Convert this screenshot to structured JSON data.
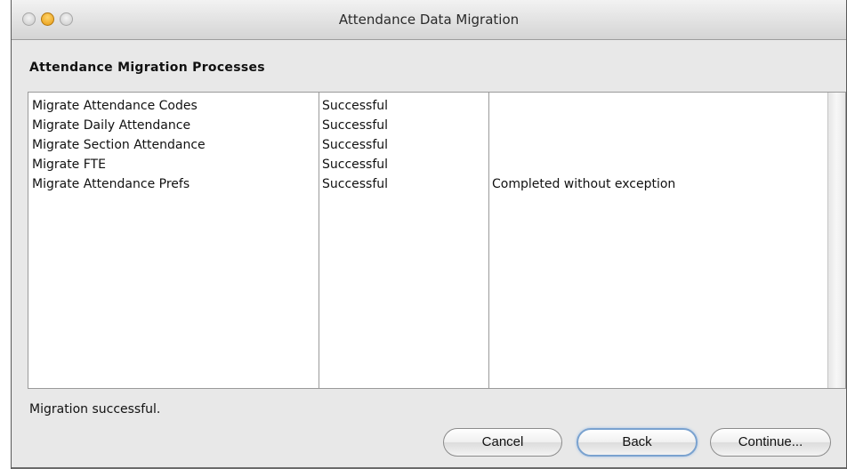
{
  "window": {
    "title": "Attendance Data Migration"
  },
  "section_heading": "Attendance Migration Processes",
  "table": {
    "rows": [
      {
        "process": "Migrate Attendance Codes",
        "result": "Successful",
        "message": ""
      },
      {
        "process": "Migrate Daily Attendance",
        "result": "Successful",
        "message": ""
      },
      {
        "process": "Migrate Section Attendance",
        "result": "Successful",
        "message": ""
      },
      {
        "process": "Migrate FTE",
        "result": "Successful",
        "message": ""
      },
      {
        "process": "Migrate Attendance Prefs",
        "result": "Successful",
        "message": "Completed without exception"
      }
    ]
  },
  "status_text": "Migration successful.",
  "buttons": {
    "cancel": "Cancel",
    "back": "Back",
    "continue": "Continue..."
  },
  "colors": {
    "window_bg": "#e8e8e8",
    "minimize_button": "#e69a12",
    "focus_ring": "#7aa2cf"
  },
  "icons": [
    "close-window-icon",
    "minimize-window-icon",
    "zoom-window-icon"
  ]
}
